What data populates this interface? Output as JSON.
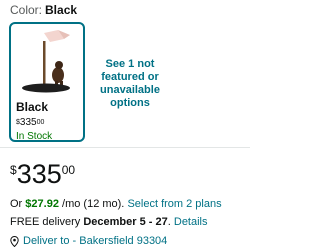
{
  "color_selector": {
    "label": "Color:",
    "value": "Black"
  },
  "swatch": {
    "name": "Black",
    "price_symbol": "$",
    "price_whole": "335",
    "price_fraction": "00",
    "stock": "In Stock",
    "image_icon": "floor-lamp-with-dog-figurine-image"
  },
  "more_options": "See 1 not featured or unavailable options",
  "price": {
    "symbol": "$",
    "whole": "335",
    "fraction": "00"
  },
  "installment": {
    "prefix": "Or",
    "amount": "$27.92",
    "term": "/mo (12 mo).",
    "plans_link": "Select from 2 plans"
  },
  "delivery": {
    "prefix": "FREE delivery",
    "date": "December 5 - 27",
    "details_link": "Details"
  },
  "deliver_to": {
    "icon": "location-pin-icon",
    "text": "Deliver to - Bakersfield 93304"
  },
  "colors": {
    "link": "#007185",
    "in_stock": "#007600",
    "selected_border": "#007185"
  }
}
